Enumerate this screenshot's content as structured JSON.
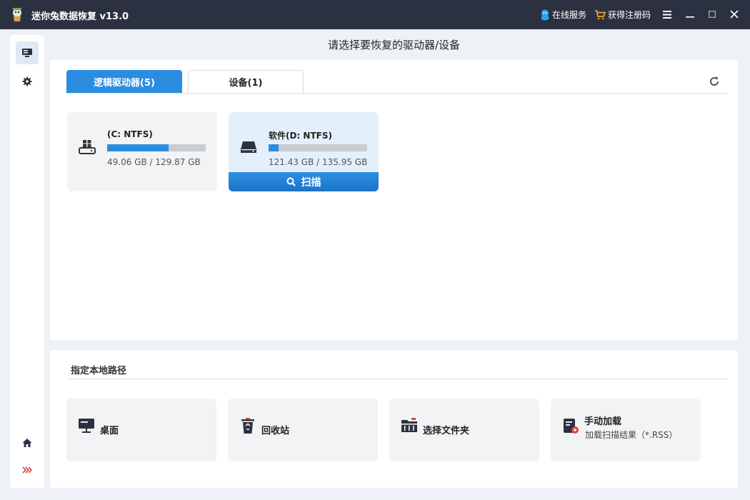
{
  "titlebar": {
    "app_title": "迷你兔数据恢复 v13.0",
    "online_service": "在线服务",
    "get_code": "获得注册码",
    "accent": "#2c3142"
  },
  "page_title": "请选择要恢复的驱动器/设备",
  "tabs": [
    {
      "label": "逻辑驱动器(5)",
      "active": true
    },
    {
      "label": "设备(1)",
      "active": false
    }
  ],
  "drives": [
    {
      "name": "(C: NTFS)",
      "size": "49.06 GB / 129.87 GB",
      "used_fraction": 0.62,
      "icon": "windows-drive-icon"
    },
    {
      "name": "软件(D: NTFS)",
      "size": "121.43 GB / 135.95 GB",
      "used_fraction": 0.1,
      "icon": "hard-drive-icon",
      "scan_label": "扫描"
    }
  ],
  "path_section": {
    "title": "指定本地路径",
    "items": [
      {
        "label": "桌面",
        "icon": "desktop-icon"
      },
      {
        "label": "回收站",
        "icon": "recycle-bin-icon"
      },
      {
        "label": "选择文件夹",
        "icon": "folder-icon"
      },
      {
        "label": "手动加载",
        "sub": "加载扫描结果（*.RSS）",
        "icon": "manual-load-icon"
      }
    ]
  },
  "colors": {
    "primary": "#2b8de0",
    "bar_bg": "#c9ccd1",
    "card_bg": "#f2f3f5",
    "selected_card_bg": "#e3f0fc"
  }
}
